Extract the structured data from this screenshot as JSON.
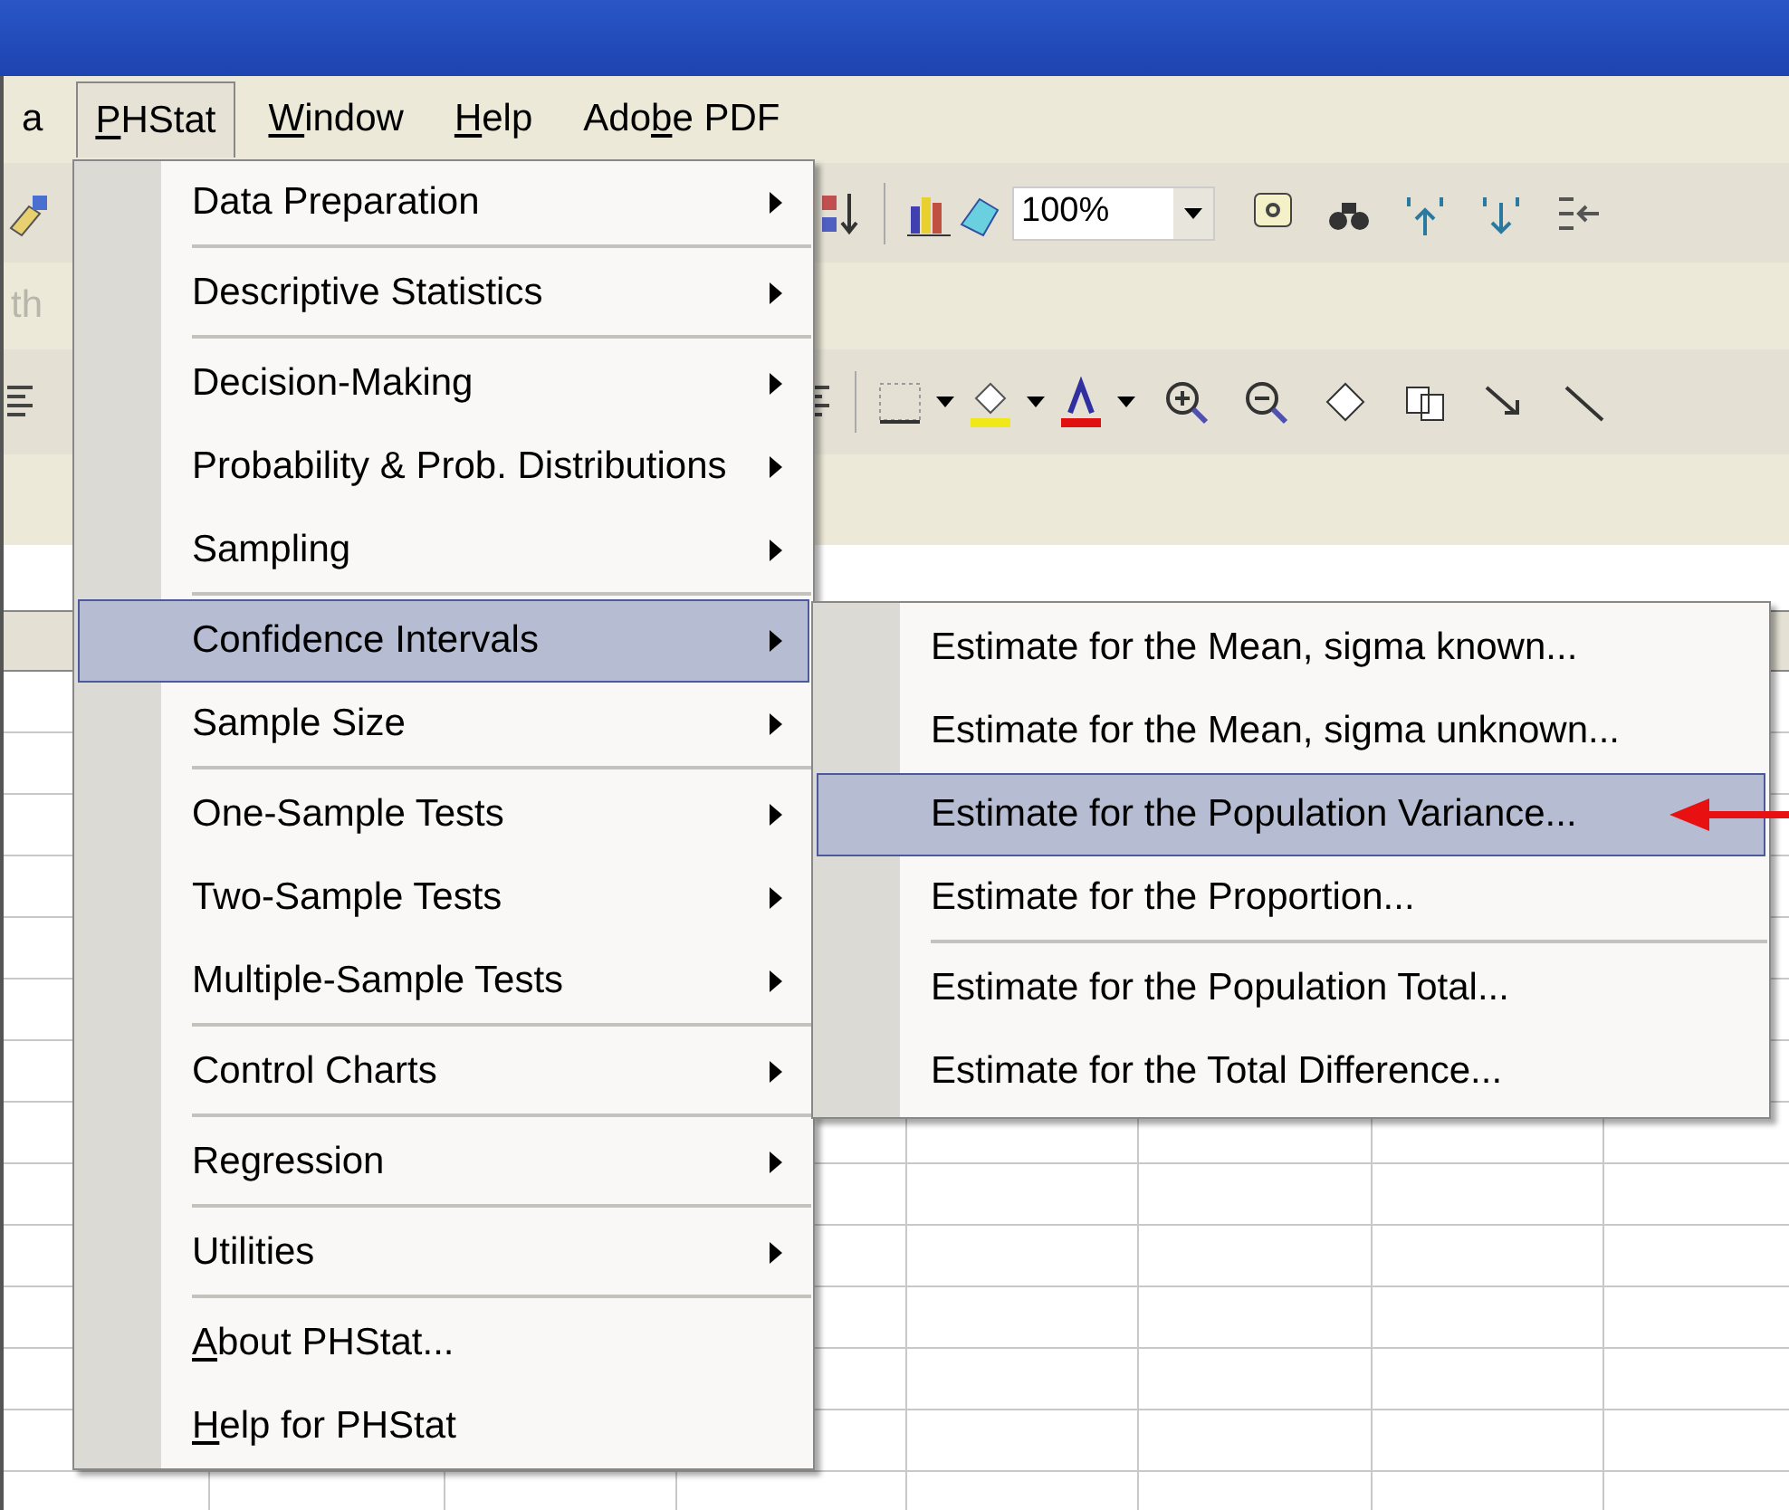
{
  "menu_bar": [
    {
      "label": "a",
      "open": false
    },
    {
      "key": "P",
      "post": "HStat",
      "open": true
    },
    {
      "key": "W",
      "post": "indow",
      "open": false
    },
    {
      "key": "H",
      "post": "elp",
      "open": false
    },
    {
      "pre": "Ado",
      "key": "b",
      "post": "e PDF",
      "open": false
    }
  ],
  "toolbar": {
    "zoom_value": "100%",
    "faded_text": "th"
  },
  "phstat_menu": [
    {
      "label": "Data Preparation",
      "submenu": true,
      "selected": false,
      "separator_after": true
    },
    {
      "label": "Descriptive Statistics",
      "submenu": true,
      "selected": false,
      "separator_after": true
    },
    {
      "label": "Decision-Making",
      "submenu": true,
      "selected": false,
      "separator_after": false
    },
    {
      "label": "Probability & Prob. Distributions",
      "submenu": true,
      "selected": false,
      "separator_after": false
    },
    {
      "label": "Sampling",
      "submenu": true,
      "selected": false,
      "separator_after": true
    },
    {
      "label": "Confidence Intervals",
      "submenu": true,
      "selected": true,
      "separator_after": false
    },
    {
      "label": "Sample Size",
      "submenu": true,
      "selected": false,
      "separator_after": true
    },
    {
      "label": "One-Sample Tests",
      "submenu": true,
      "selected": false,
      "separator_after": false
    },
    {
      "label": "Two-Sample Tests",
      "submenu": true,
      "selected": false,
      "separator_after": false
    },
    {
      "label": "Multiple-Sample Tests",
      "submenu": true,
      "selected": false,
      "separator_after": true
    },
    {
      "label": "Control Charts",
      "submenu": true,
      "selected": false,
      "separator_after": true
    },
    {
      "label": "Regression",
      "submenu": true,
      "selected": false,
      "separator_after": true
    },
    {
      "label": "Utilities",
      "submenu": true,
      "selected": false,
      "separator_after": true
    },
    {
      "key": "A",
      "post": "bout PHStat...",
      "submenu": false,
      "selected": false,
      "separator_after": false
    },
    {
      "key": "H",
      "post": "elp for PHStat",
      "submenu": false,
      "selected": false,
      "separator_after": false
    }
  ],
  "confidence_submenu": [
    {
      "label": "Estimate for the Mean, sigma known...",
      "selected": false,
      "separator_after": false,
      "pointed_at": false
    },
    {
      "label": "Estimate for the Mean, sigma unknown...",
      "selected": false,
      "separator_after": false,
      "pointed_at": false
    },
    {
      "label": "Estimate for the Population Variance...",
      "selected": true,
      "separator_after": false,
      "pointed_at": true
    },
    {
      "label": "Estimate for the Proportion...",
      "selected": false,
      "separator_after": true,
      "pointed_at": false
    },
    {
      "label": "Estimate for the Population Total...",
      "selected": false,
      "separator_after": false,
      "pointed_at": false
    },
    {
      "label": "Estimate for the Total Difference...",
      "selected": false,
      "separator_after": false,
      "pointed_at": false
    }
  ]
}
